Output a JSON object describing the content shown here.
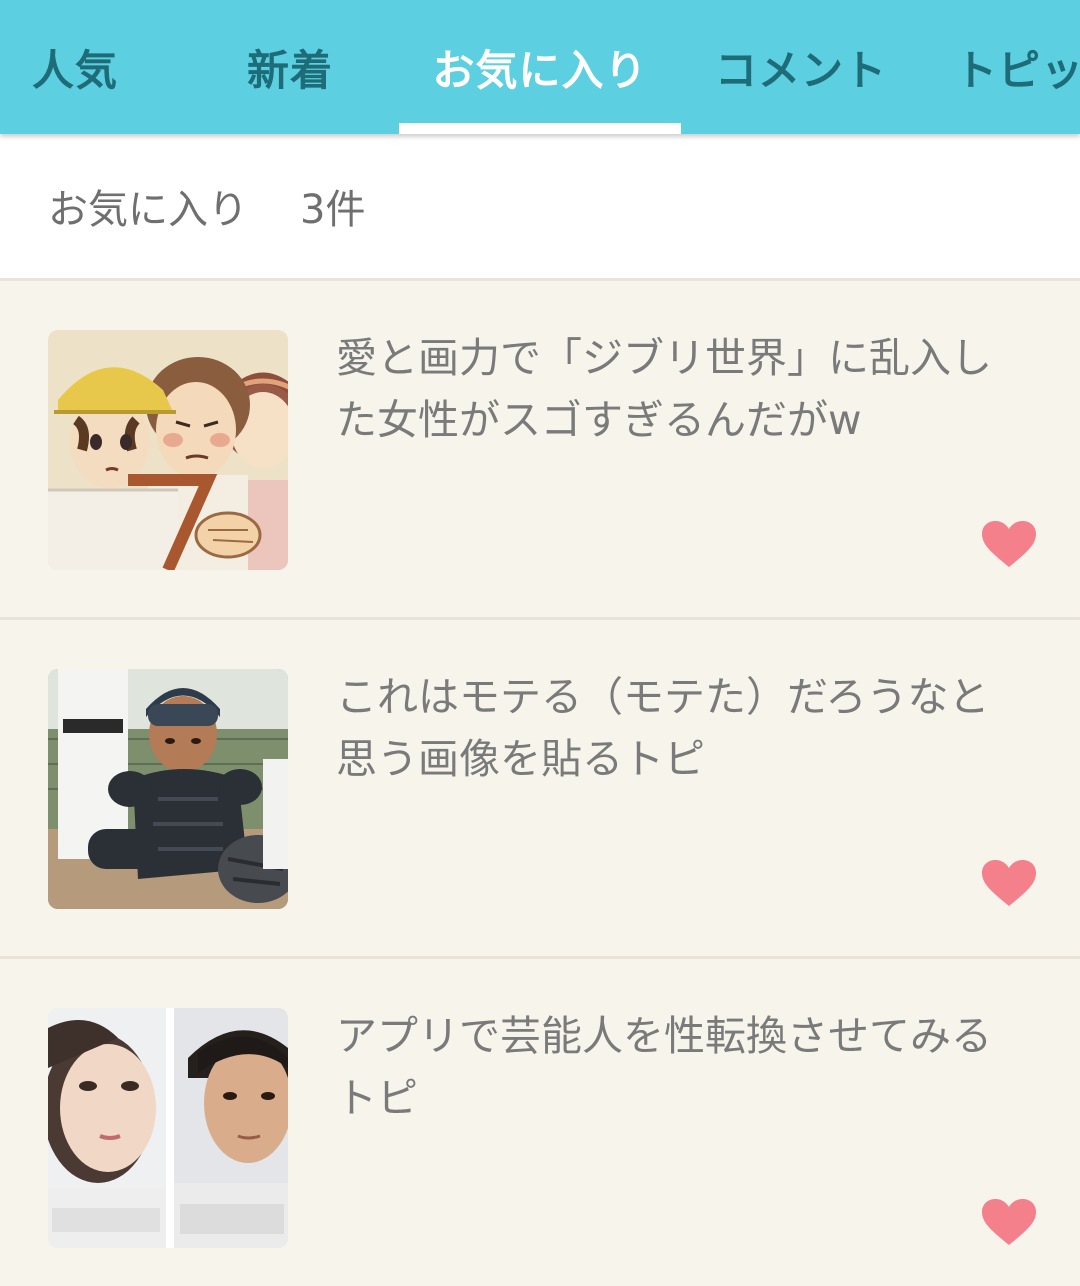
{
  "tabs": [
    {
      "label": "人気",
      "active": false
    },
    {
      "label": "新着",
      "active": false
    },
    {
      "label": "お気に入り",
      "active": true
    },
    {
      "label": "コメント",
      "active": false
    },
    {
      "label": "トピック",
      "active": false
    }
  ],
  "header": {
    "label": "お気に入り",
    "count": "3件"
  },
  "items": [
    {
      "title": "愛と画力で「ジブリ世界」に乱入した女性がスゴすぎるんだがw",
      "favorite_icon": "heart-icon"
    },
    {
      "title": "これはモテる（モテた）だろうなと思う画像を貼るトピ",
      "favorite_icon": "heart-icon"
    },
    {
      "title": "アプリで芸能人を性転換させてみるトピ",
      "favorite_icon": "heart-icon"
    }
  ],
  "colors": {
    "tabbar": "#5ccfe0",
    "tab_inactive_text": "#1d6c78",
    "tab_active_text": "#ffffff",
    "list_background": "#f7f4ec",
    "heart": "#f3808a",
    "body_text": "#7a7a7a"
  }
}
